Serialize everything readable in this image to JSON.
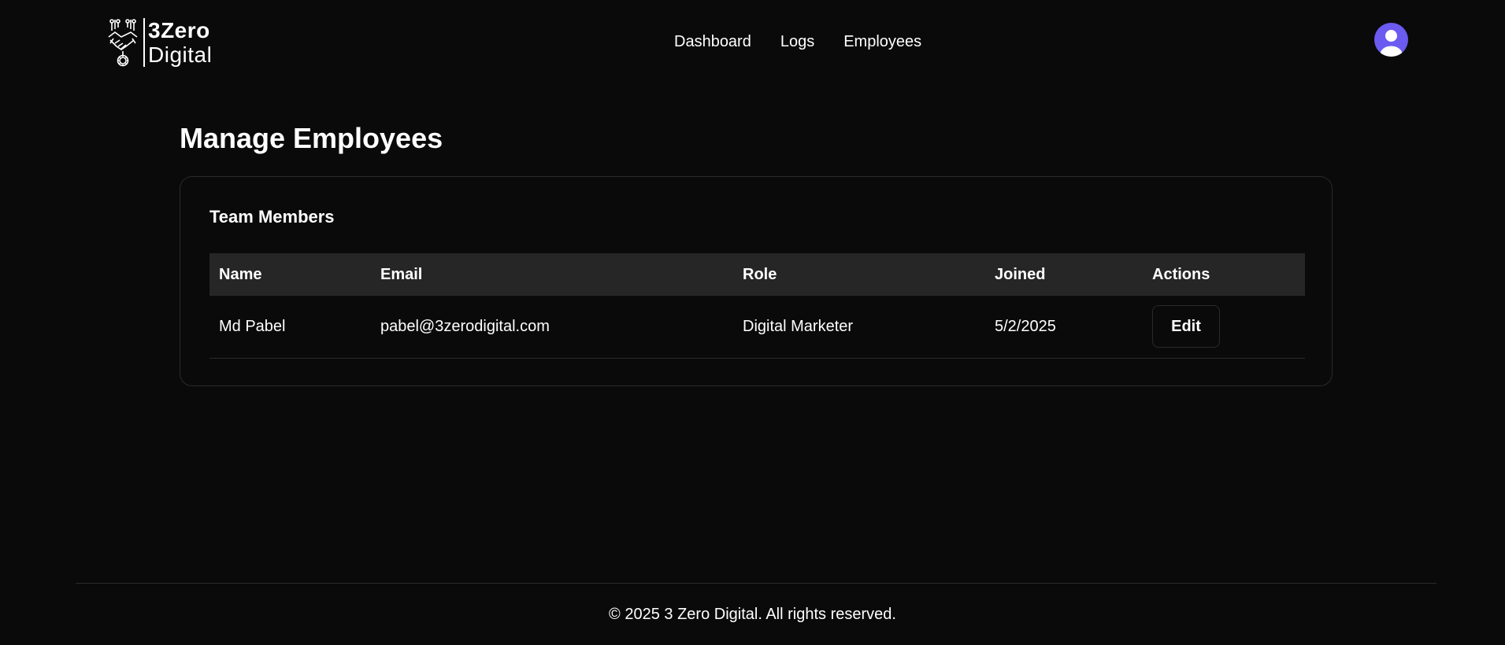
{
  "brand": {
    "line1": "3Zero",
    "line2": "Digital",
    "icon": "handshake-gear-logo-icon"
  },
  "nav": {
    "items": [
      {
        "label": "Dashboard"
      },
      {
        "label": "Logs"
      },
      {
        "label": "Employees"
      }
    ]
  },
  "user": {
    "avatar_icon": "user-avatar-icon",
    "avatar_color": "#6b5bf0"
  },
  "main": {
    "title": "Manage Employees",
    "card": {
      "title": "Team Members",
      "columns": [
        "Name",
        "Email",
        "Role",
        "Joined",
        "Actions"
      ],
      "rows": [
        {
          "name": "Md Pabel",
          "email": "pabel@3zerodigital.com",
          "role": "Digital Marketer",
          "joined": "5/2/2025",
          "action_label": "Edit"
        }
      ]
    }
  },
  "footer": {
    "text": "© 2025 3 Zero Digital. All rights reserved."
  },
  "colors": {
    "background": "#0a0a0a",
    "header_row": "#262626",
    "border": "#2a2a2a",
    "text": "#ffffff"
  }
}
